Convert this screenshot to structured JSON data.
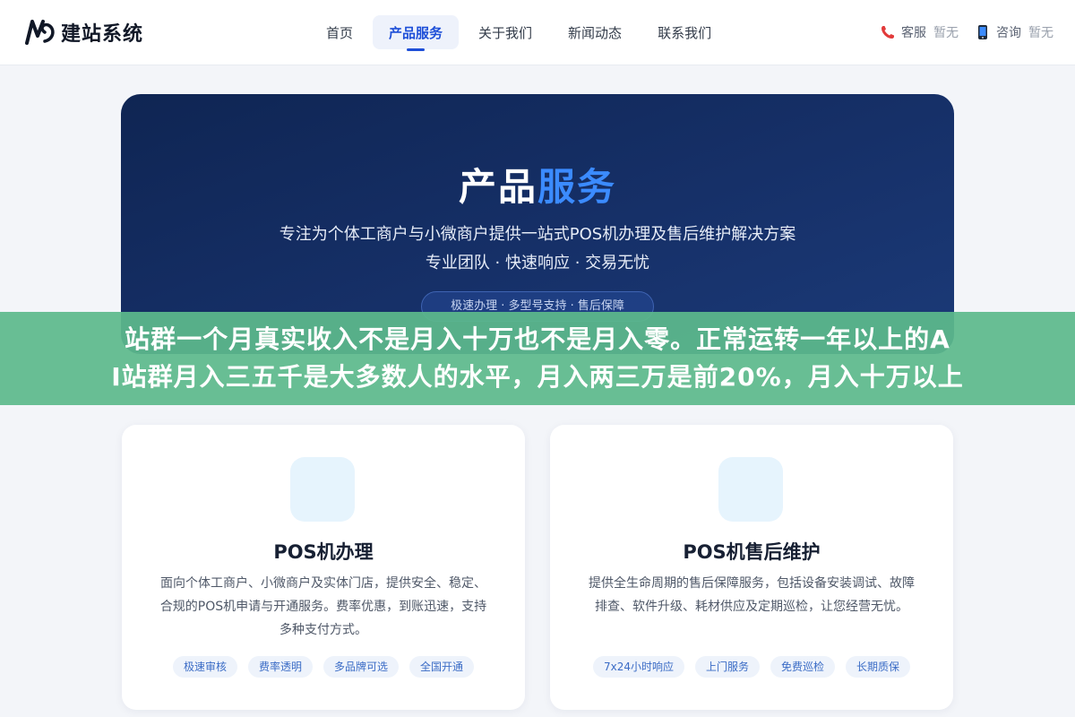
{
  "header": {
    "logo_text": "建站系统",
    "nav": [
      {
        "label": "首页",
        "active": false
      },
      {
        "label": "产品服务",
        "active": true
      },
      {
        "label": "关于我们",
        "active": false
      },
      {
        "label": "新闻动态",
        "active": false
      },
      {
        "label": "联系我们",
        "active": false
      }
    ],
    "contact": [
      {
        "icon": "phone-icon",
        "label": "客服",
        "value": "暂无"
      },
      {
        "icon": "mobile-icon",
        "label": "咨询",
        "value": "暂无"
      }
    ]
  },
  "hero": {
    "title_part1": "产品",
    "title_part2": "服务",
    "subtitle1": "专注为个体工商户与小微商户提供一站式POS机办理及售后维护解决方案",
    "subtitle2": "专业团队 · 快速响应 · 交易无忧",
    "pill": "极速办理 · 多型号支持 · 售后保障"
  },
  "banner": {
    "line1": "站群一个月真实收入不是月入十万也不是月入零。正常运转一年以上的A",
    "line2": "I站群月入三五千是大多数人的水平，月入两三万是前20%，月入十万以上"
  },
  "cards": [
    {
      "title": "POS机办理",
      "desc": "面向个体工商户、小微商户及实体门店，提供安全、稳定、合规的POS机申请与开通服务。费率优惠，到账迅速，支持多种支付方式。",
      "tags": [
        "极速审核",
        "费率透明",
        "多品牌可选",
        "全国开通"
      ]
    },
    {
      "title": "POS机售后维护",
      "desc": "提供全生命周期的售后保障服务，包括设备安装调试、故障排查、软件升级、耗材供应及定期巡检，让您经营无忧。",
      "tags": [
        "7x24小时响应",
        "上门服务",
        "免费巡检",
        "长期质保"
      ]
    }
  ],
  "colors": {
    "accent": "#1e4fd8",
    "hero_highlight": "#3b8bff",
    "hero_bg": "#163068",
    "banner_bg": "#5cb98c",
    "tag_text": "#3b6cc6"
  }
}
